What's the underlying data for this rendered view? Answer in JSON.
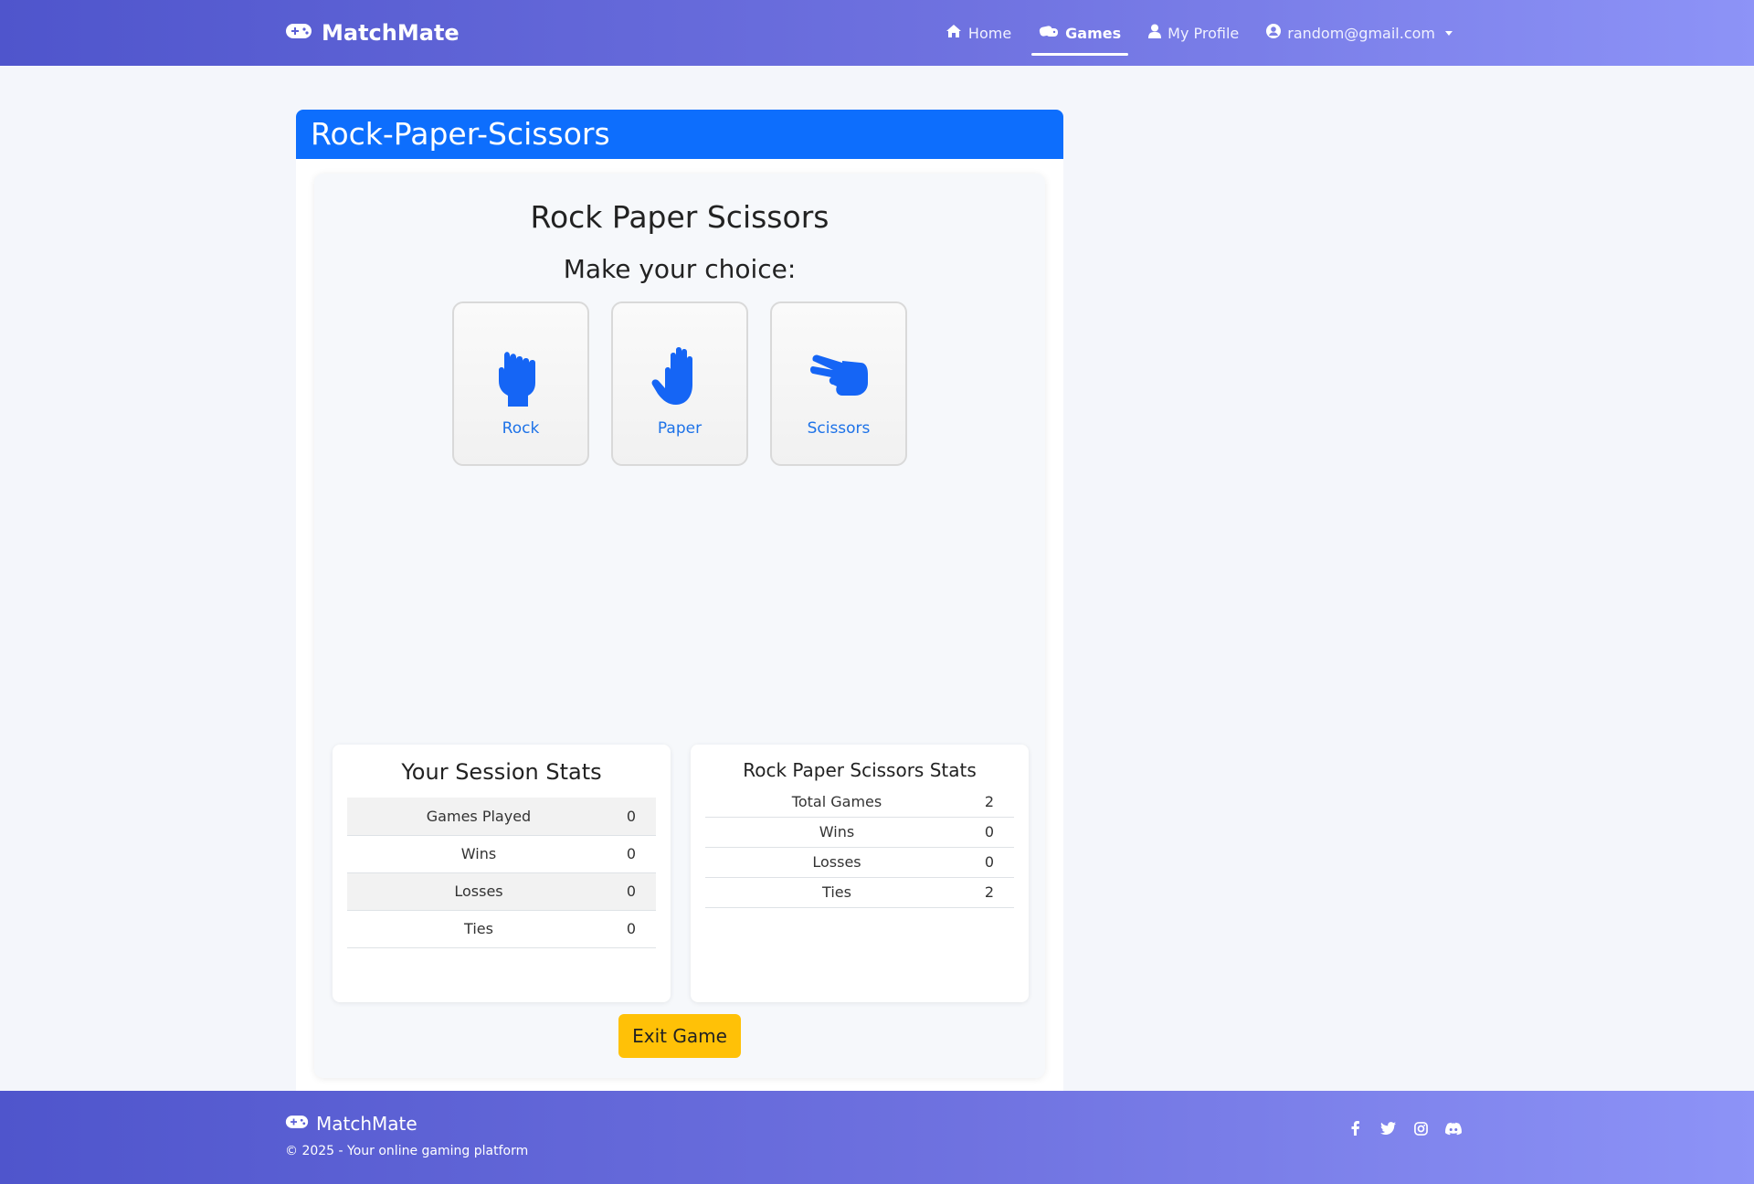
{
  "nav": {
    "brand": "MatchMate",
    "items": [
      {
        "label": "Home",
        "icon": "home-icon",
        "active": false
      },
      {
        "label": "Games",
        "icon": "gamepad-icon",
        "active": true
      },
      {
        "label": "My Profile",
        "icon": "user-icon",
        "active": false
      }
    ],
    "account": "random@gmail.com"
  },
  "card": {
    "header": "Rock-Paper-Scissors",
    "title": "Rock Paper Scissors",
    "prompt": "Make your choice:",
    "choices": [
      {
        "label": "Rock",
        "icon": "hand-rock-icon"
      },
      {
        "label": "Paper",
        "icon": "hand-paper-icon"
      },
      {
        "label": "Scissors",
        "icon": "hand-scissors-icon"
      }
    ],
    "accent": "#0d6efd"
  },
  "session_stats": {
    "title": "Your Session Stats",
    "rows": [
      {
        "label": "Games Played",
        "value": "0"
      },
      {
        "label": "Wins",
        "value": "0"
      },
      {
        "label": "Losses",
        "value": "0"
      },
      {
        "label": "Ties",
        "value": "0"
      }
    ]
  },
  "game_stats": {
    "title": "Rock Paper Scissors Stats",
    "rows": [
      {
        "label": "Total Games",
        "value": "2"
      },
      {
        "label": "Wins",
        "value": "0"
      },
      {
        "label": "Losses",
        "value": "0"
      },
      {
        "label": "Ties",
        "value": "2"
      }
    ]
  },
  "exit_label": "Exit Game",
  "exit_color": "#ffc107",
  "footer": {
    "brand": "MatchMate",
    "copyright": "© 2025 - Your online gaming platform",
    "social": [
      "facebook-icon",
      "twitter-icon",
      "instagram-icon",
      "discord-icon"
    ]
  }
}
